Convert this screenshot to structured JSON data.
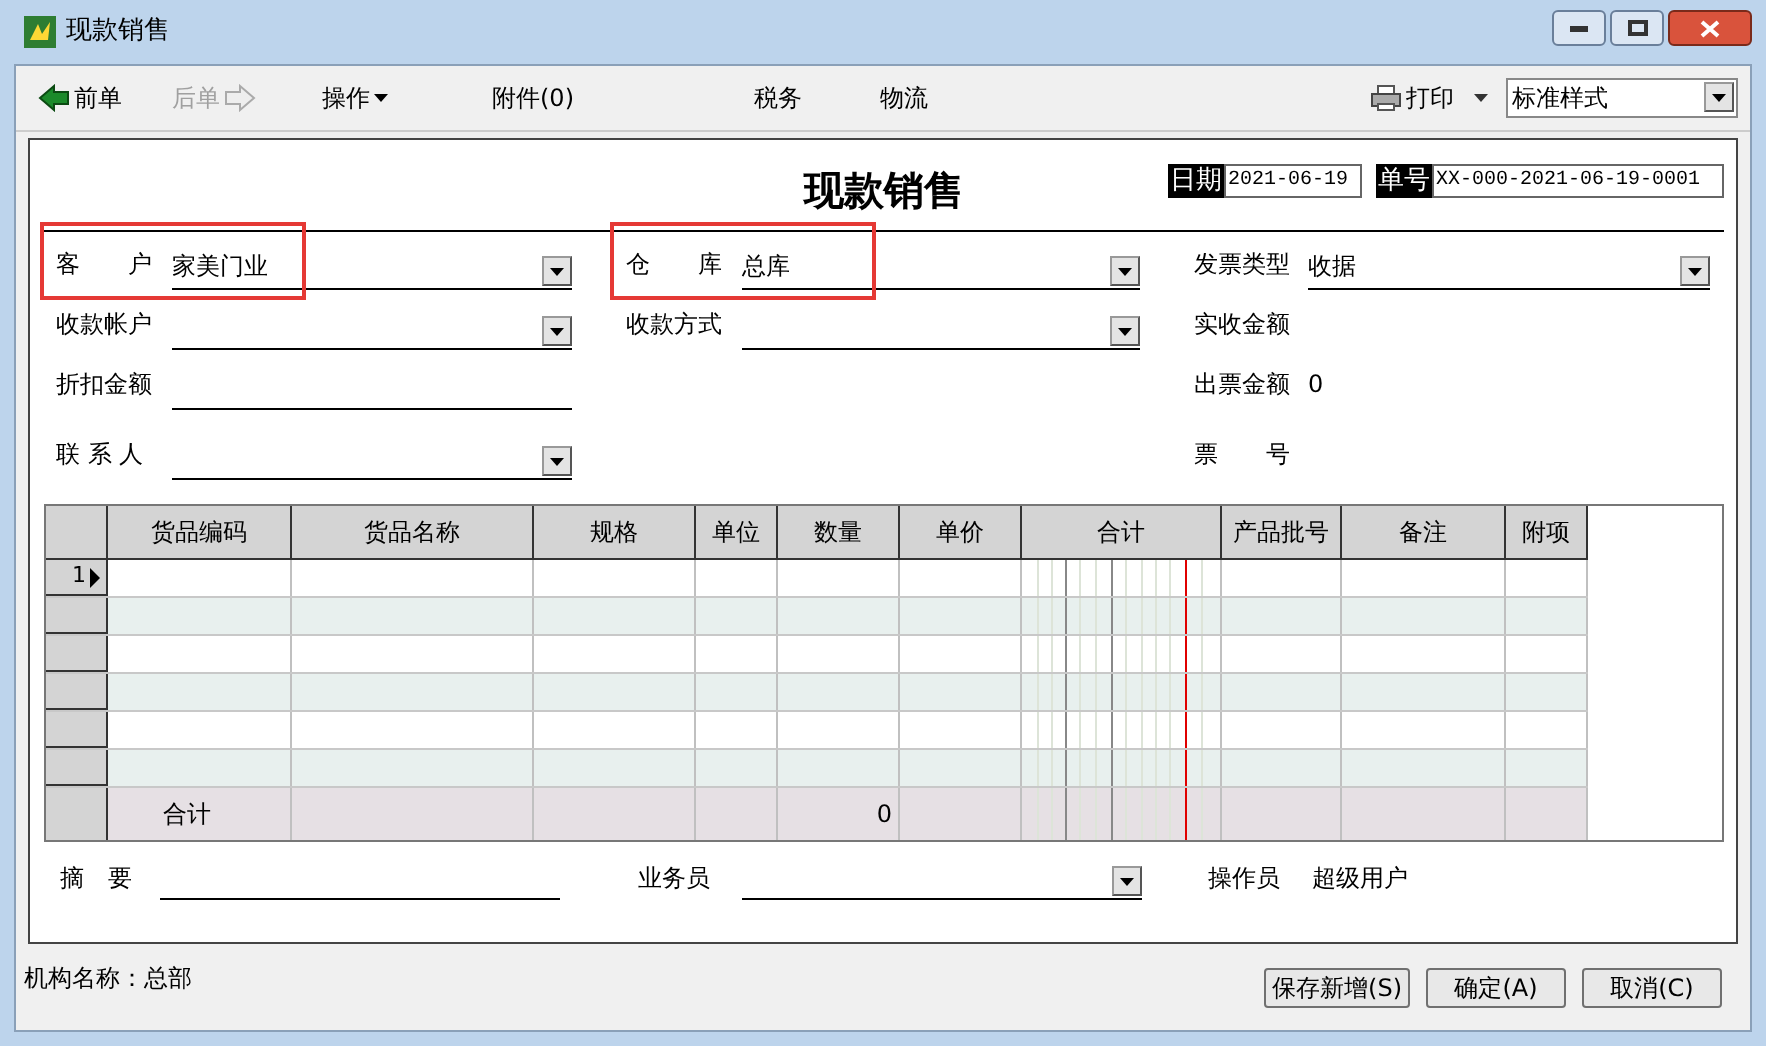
{
  "window": {
    "title": "现款销售"
  },
  "toolbar": {
    "items": [
      {
        "label": "前单",
        "kind": "back",
        "disabled": false
      },
      {
        "label": "后单",
        "kind": "forward",
        "disabled": true
      },
      {
        "label": "操作",
        "kind": "menu",
        "disabled": false
      },
      {
        "label": "附件(0)",
        "kind": "plain",
        "disabled": false
      },
      {
        "label": "税务",
        "kind": "plain",
        "disabled": false
      },
      {
        "label": "物流",
        "kind": "plain",
        "disabled": false
      }
    ],
    "print": {
      "label": "打印"
    },
    "style_select": {
      "value": "标准样式"
    }
  },
  "form": {
    "title": "现款销售",
    "date_label": "日期",
    "date": "2021-06-19",
    "number_label": "单号",
    "number": "XX-000-2021-06-19-0001",
    "columns": [
      [
        {
          "label": "客　　户",
          "value": "家美门业",
          "kind": "dropdown",
          "highlighted": true
        },
        {
          "label": "收款帐户",
          "kind": "dropdown"
        },
        {
          "label": "折扣金额",
          "kind": "input"
        },
        {
          "label": "联 系 人",
          "kind": "dropdown"
        }
      ],
      [
        {
          "label": "仓　　库",
          "value": "总库",
          "kind": "dropdown",
          "highlighted": true
        },
        {
          "label": "收款方式",
          "kind": "dropdown"
        }
      ],
      [
        {
          "label": "发票类型",
          "value": "收据",
          "kind": "dropdown"
        },
        {
          "label": "实收金额",
          "kind": "readout"
        },
        {
          "label": "出票金额",
          "value": "0",
          "kind": "readout"
        },
        {
          "label": "票　　号",
          "kind": "readout"
        }
      ]
    ]
  },
  "table": {
    "columns": [
      "货品编码",
      "货品名称",
      "规格",
      "单位",
      "数量",
      "单价",
      "合计",
      "产品批号",
      "备注",
      "附项"
    ],
    "rows": [
      {
        "number": "1",
        "current": true
      },
      {
        "current": false
      },
      {
        "current": false
      },
      {
        "current": false
      },
      {
        "current": false
      },
      {
        "current": false
      }
    ],
    "totals": {
      "label": "合计",
      "quantity": "0"
    }
  },
  "footer_fields": [
    {
      "label": "摘　要",
      "kind": "input"
    },
    {
      "label": "业务员",
      "kind": "dropdown"
    },
    {
      "label": "操作员",
      "value": "超级用户",
      "kind": "readout"
    }
  ],
  "status": {
    "org": "机构名称：总部",
    "buttons": [
      "保存新增(S)",
      "确定(A)",
      "取消(C)"
    ]
  }
}
